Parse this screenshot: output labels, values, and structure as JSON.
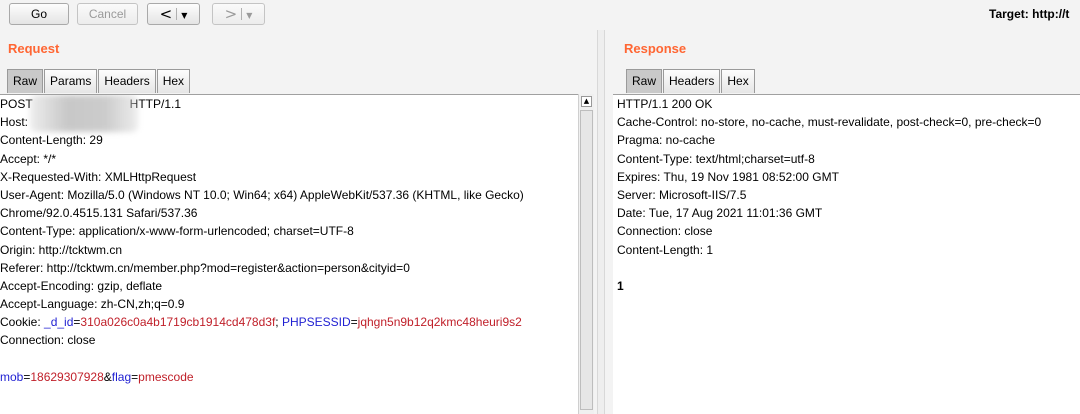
{
  "toolbar": {
    "go_label": "Go",
    "cancel_label": "Cancel",
    "back_arrow": "<",
    "forward_arrow": ">",
    "dropdown_glyph": "▼",
    "target_text": "Target: http://t"
  },
  "request": {
    "title": "Request",
    "tabs": [
      {
        "label": "Raw",
        "active": true
      },
      {
        "label": "Params",
        "active": false
      },
      {
        "label": "Headers",
        "active": false
      },
      {
        "label": "Hex",
        "active": false
      }
    ],
    "lines": [
      "POST",
      "HTTP/1.1",
      "Host:",
      "Content-Length: 29",
      "Accept: */*",
      "X-Requested-With: XMLHttpRequest",
      "User-Agent: Mozilla/5.0 (Windows NT 10.0; Win64; x64) AppleWebKit/537.36 (KHTML, like Gecko)",
      "Chrome/92.0.4515.131 Safari/537.36",
      "Content-Type: application/x-www-form-urlencoded; charset=UTF-8",
      "Origin: http://tcktwm.cn",
      "Referer: http://tcktwm.cn/member.php?mod=register&action=person&cityid=0",
      "Accept-Encoding: gzip, deflate",
      "Accept-Language: zh-CN,zh;q=0.9"
    ],
    "cookie": {
      "label": "Cookie: ",
      "k1": "_d_id",
      "eq1": "=",
      "v1": "310a026c0a4b1719cb1914cd478d3f",
      "sep": "; ",
      "k2": "PHPSESSID",
      "eq2": "=",
      "v2": "jqhgn5n9b12q2kmc48heuri9s2"
    },
    "connection": "Connection: close",
    "body": {
      "k1": "mob",
      "eq1": "=",
      "v1": "18629307928",
      "amp": "&",
      "k2": "flag",
      "eq2": "=",
      "v2": "pmescode"
    }
  },
  "response": {
    "title": "Response",
    "tabs": [
      {
        "label": "Raw",
        "active": true
      },
      {
        "label": "Headers",
        "active": false
      },
      {
        "label": "Hex",
        "active": false
      }
    ],
    "lines": [
      "HTTP/1.1 200 OK",
      "Cache-Control: no-store, no-cache, must-revalidate, post-check=0, pre-check=0",
      "Pragma: no-cache",
      "Content-Type: text/html;charset=utf-8",
      "Expires: Thu, 19 Nov 1981 08:52:00 GMT",
      "Server: Microsoft-IIS/7.5",
      "Date: Tue, 17 Aug 2021 11:01:36 GMT",
      "Connection: close",
      "Content-Length: 1",
      "",
      "1"
    ]
  },
  "scrollbar": {
    "up_glyph": "▲"
  }
}
